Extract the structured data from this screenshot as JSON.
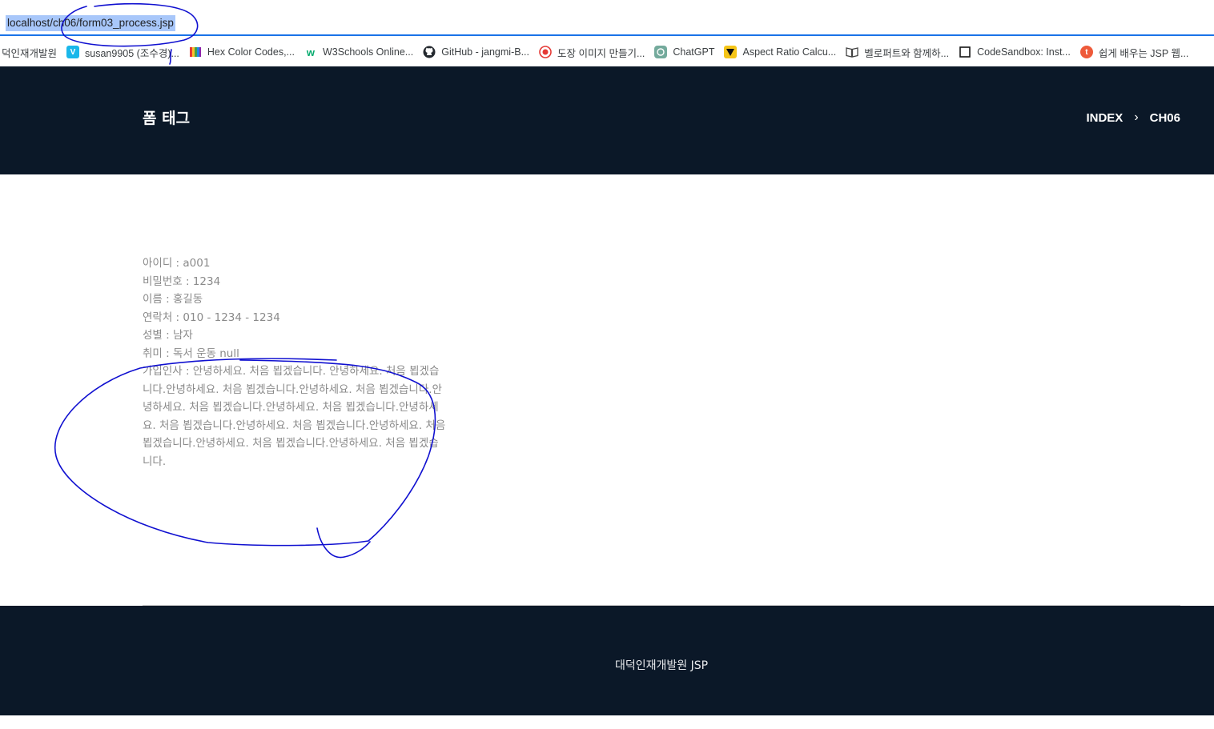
{
  "browser": {
    "url": "localhost/ch06/form03_process.jsp",
    "bookmarks": [
      {
        "label": "덕인재개발원",
        "icon": "none",
        "color": ""
      },
      {
        "label": "susan9905 (조수경)...",
        "icon": "vimeo-icon",
        "color": "#1ab7ea"
      },
      {
        "label": "Hex Color Codes,...",
        "icon": "color-palette-icon",
        "color": "#f4b400"
      },
      {
        "label": "W3Schools Online...",
        "icon": "w3schools-icon",
        "color": "#04aa6d"
      },
      {
        "label": "GitHub - jangmi-B...",
        "icon": "github-icon",
        "color": "#24292f"
      },
      {
        "label": "도장 이미지 만들기...",
        "icon": "stamp-icon",
        "color": "#e53935"
      },
      {
        "label": "ChatGPT",
        "icon": "chatgpt-icon",
        "color": "#74aa9c"
      },
      {
        "label": "Aspect Ratio Calcu...",
        "icon": "aspect-ratio-icon",
        "color": "#f5c518"
      },
      {
        "label": "벨로퍼트와 함께하...",
        "icon": "book-icon",
        "color": "#555555"
      },
      {
        "label": "CodeSandbox: Inst...",
        "icon": "codesandbox-icon",
        "color": "#151515"
      },
      {
        "label": "쉽게 배우는 JSP 웹...",
        "icon": "tistory-icon",
        "color": "#ee5a3a"
      }
    ]
  },
  "header": {
    "title": "폼 태그",
    "breadcrumb": [
      "INDEX",
      "CH06"
    ],
    "separator": "›",
    "bg_color": "#0b1828"
  },
  "content": {
    "id_line": "아이디 : a001",
    "password_line": "비밀번호 : 1234",
    "name_line": "이름 : 홍길동",
    "phone_line": "연락처 : 010 - 1234 - 1234",
    "gender_line": "성별 : 남자",
    "hobby_line": "취미 : 독서 운동 null",
    "greeting_line": "가입인사 : 안녕하세요. 처음 뵙겠습니다. 안녕하세요. 처음 뵙겠습니다.안녕하세요. 처음 뵙겠습니다.안녕하세요. 처음 뵙겠습니다.안녕하세요. 처음 뵙겠습니다.안녕하세요. 처음 뵙겠습니다.안녕하세요. 처음 뵙겠습니다.안녕하세요. 처음 뵙겠습니다.안녕하세요. 처음 뵙겠습니다.안녕하세요. 처음 뵙겠습니다.안녕하세요. 처음 뵙겠습니다."
  },
  "footer": {
    "text": "대덕인재개발원 JSP"
  },
  "annotation_color": "#1010d0"
}
